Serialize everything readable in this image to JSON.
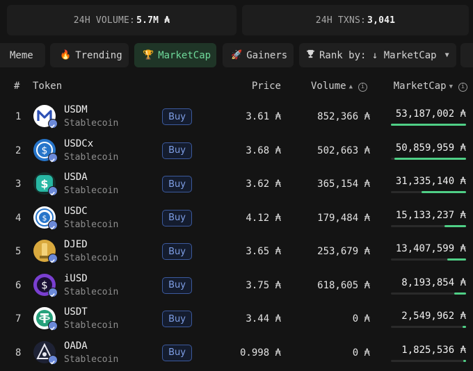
{
  "stats": {
    "volume_label": "24H VOLUME:",
    "volume_value": "5.7M ₳",
    "txns_label": "24H TXNS:",
    "txns_value": "3,041"
  },
  "tabs": {
    "meme": "Meme",
    "trending": "Trending",
    "marketcap": "MarketCap",
    "gainers": "Gainers",
    "rank": "Rank by: ↓ MarketCap"
  },
  "table": {
    "headers": {
      "num": "#",
      "token": "Token",
      "price": "Price",
      "volume": "Volume",
      "marketcap": "MarketCap"
    },
    "buy_label": "Buy",
    "rows": [
      {
        "num": "1",
        "symbol": "USDM",
        "category": "Stablecoin",
        "price": "3.61 ₳",
        "volume": "852,366 ₳",
        "marketcap": "53,187,002 ₳",
        "mcap_share": 1.0,
        "logo": "usdm-logo",
        "logo_color": "#ffffff"
      },
      {
        "num": "2",
        "symbol": "USDCx",
        "category": "Stablecoin",
        "price": "3.68 ₳",
        "volume": "502,663 ₳",
        "marketcap": "50,859,959 ₳",
        "mcap_share": 0.956,
        "logo": "usdcx-logo",
        "logo_color": "#2775ca"
      },
      {
        "num": "3",
        "symbol": "USDA",
        "category": "Stablecoin",
        "price": "3.62 ₳",
        "volume": "365,154 ₳",
        "marketcap": "31,335,140 ₳",
        "mcap_share": 0.589,
        "logo": "usda-logo",
        "logo_color": "#28b8a4"
      },
      {
        "num": "4",
        "symbol": "USDC",
        "category": "Stablecoin",
        "price": "4.12 ₳",
        "volume": "179,484 ₳",
        "marketcap": "15,133,237 ₳",
        "mcap_share": 0.285,
        "logo": "usdc-logo",
        "logo_color": "#ffffff"
      },
      {
        "num": "5",
        "symbol": "DJED",
        "category": "Stablecoin",
        "price": "3.65 ₳",
        "volume": "253,679 ₳",
        "marketcap": "13,407,599 ₳",
        "mcap_share": 0.252,
        "logo": "djed-logo",
        "logo_color": "#d9a93e"
      },
      {
        "num": "6",
        "symbol": "iUSD",
        "category": "Stablecoin",
        "price": "3.75 ₳",
        "volume": "618,605 ₳",
        "marketcap": "8,193,854 ₳",
        "mcap_share": 0.154,
        "logo": "iusd-logo",
        "logo_color": "#7a3fd1"
      },
      {
        "num": "7",
        "symbol": "USDT",
        "category": "Stablecoin",
        "price": "3.44 ₳",
        "volume": "0 ₳",
        "marketcap": "2,549,962 ₳",
        "mcap_share": 0.048,
        "logo": "usdt-logo",
        "logo_color": "#ffffff"
      },
      {
        "num": "8",
        "symbol": "OADA",
        "category": "Stablecoin",
        "price": "0.998 ₳",
        "volume": "0 ₳",
        "marketcap": "1,825,536 ₳",
        "mcap_share": 0.034,
        "logo": "oada-logo",
        "logo_color": "#1e2235"
      }
    ]
  },
  "colors": {
    "accent_green": "#4fcf86",
    "buy_blue": "#7f9fe6",
    "verified_badge": "#6b89d8"
  }
}
